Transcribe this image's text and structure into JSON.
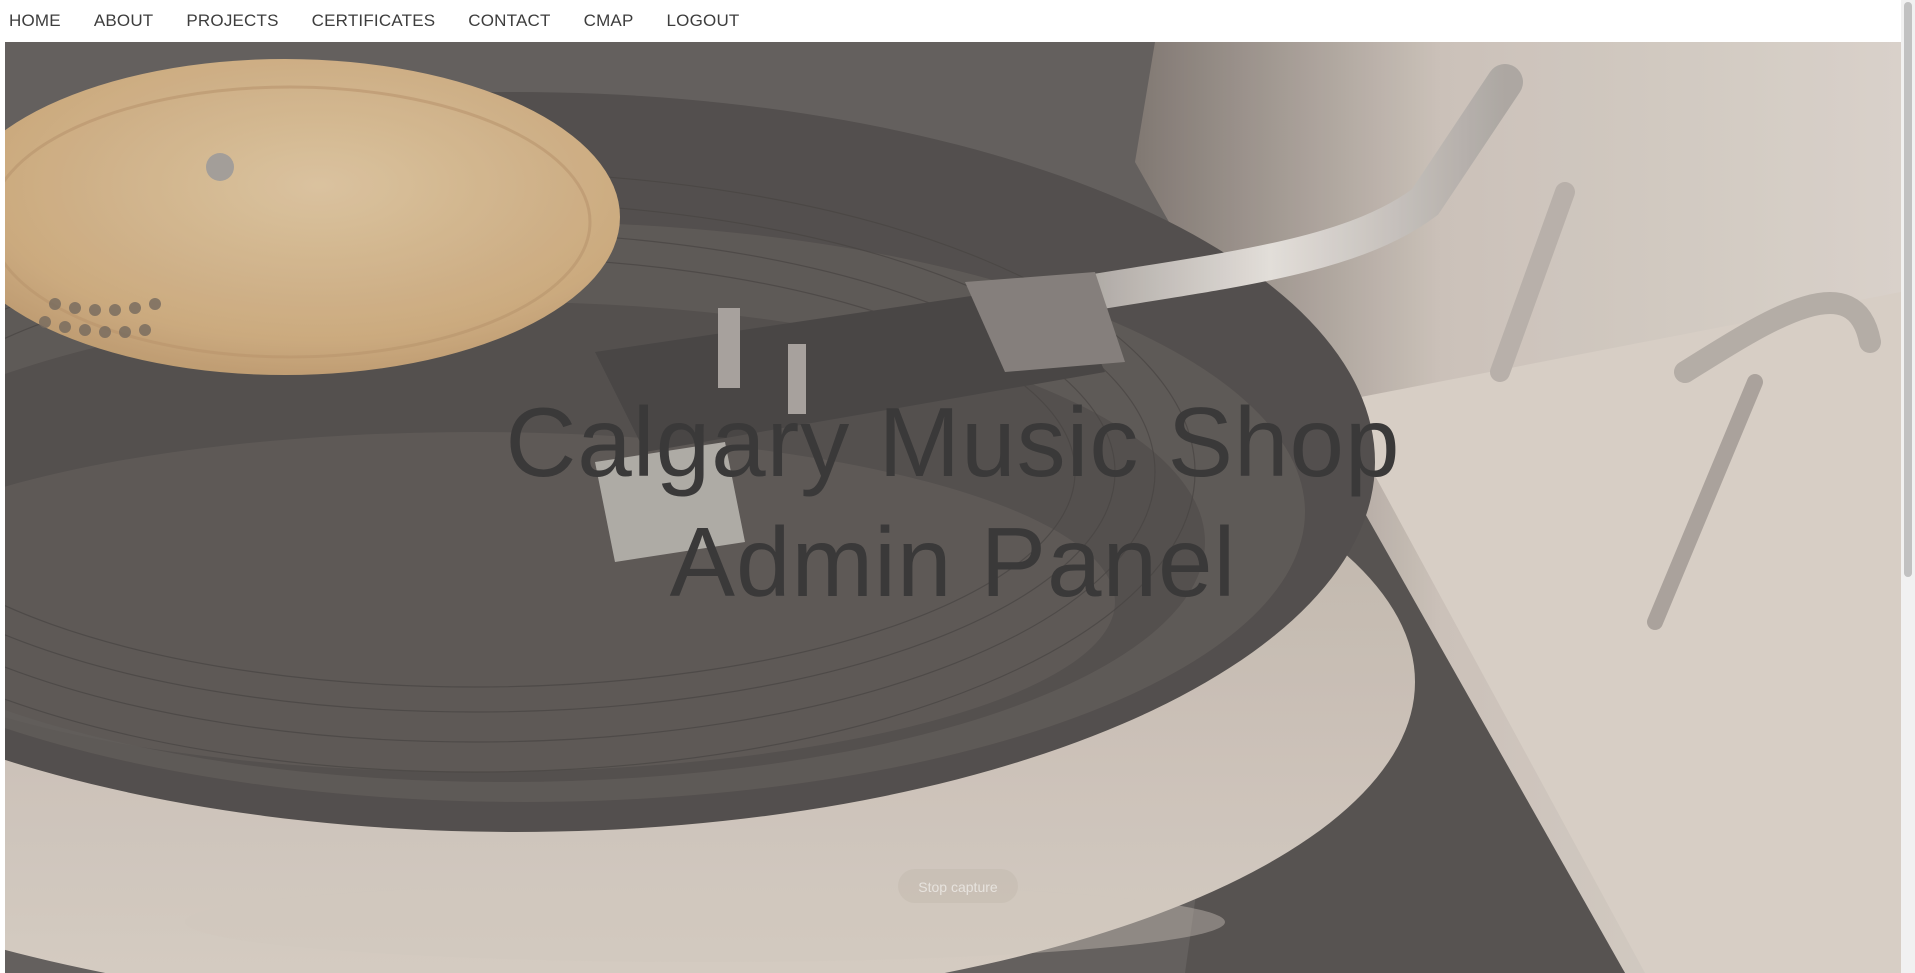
{
  "nav": {
    "items": [
      {
        "label": "HOME"
      },
      {
        "label": "ABOUT"
      },
      {
        "label": "PROJECTS"
      },
      {
        "label": "CERTIFICATES"
      },
      {
        "label": "CONTACT"
      },
      {
        "label": "CMAP"
      },
      {
        "label": "LOGOUT"
      }
    ]
  },
  "hero": {
    "title_line1": "Calgary Music Shop",
    "title_line2": "Admin Panel",
    "background_image": "turntable-record-photo-icon"
  },
  "overlay": {
    "stop_capture_label": "Stop capture"
  },
  "colors": {
    "nav_text": "#3d3d3d",
    "title_text": "#3a3939",
    "nav_bg": "#ffffff"
  }
}
